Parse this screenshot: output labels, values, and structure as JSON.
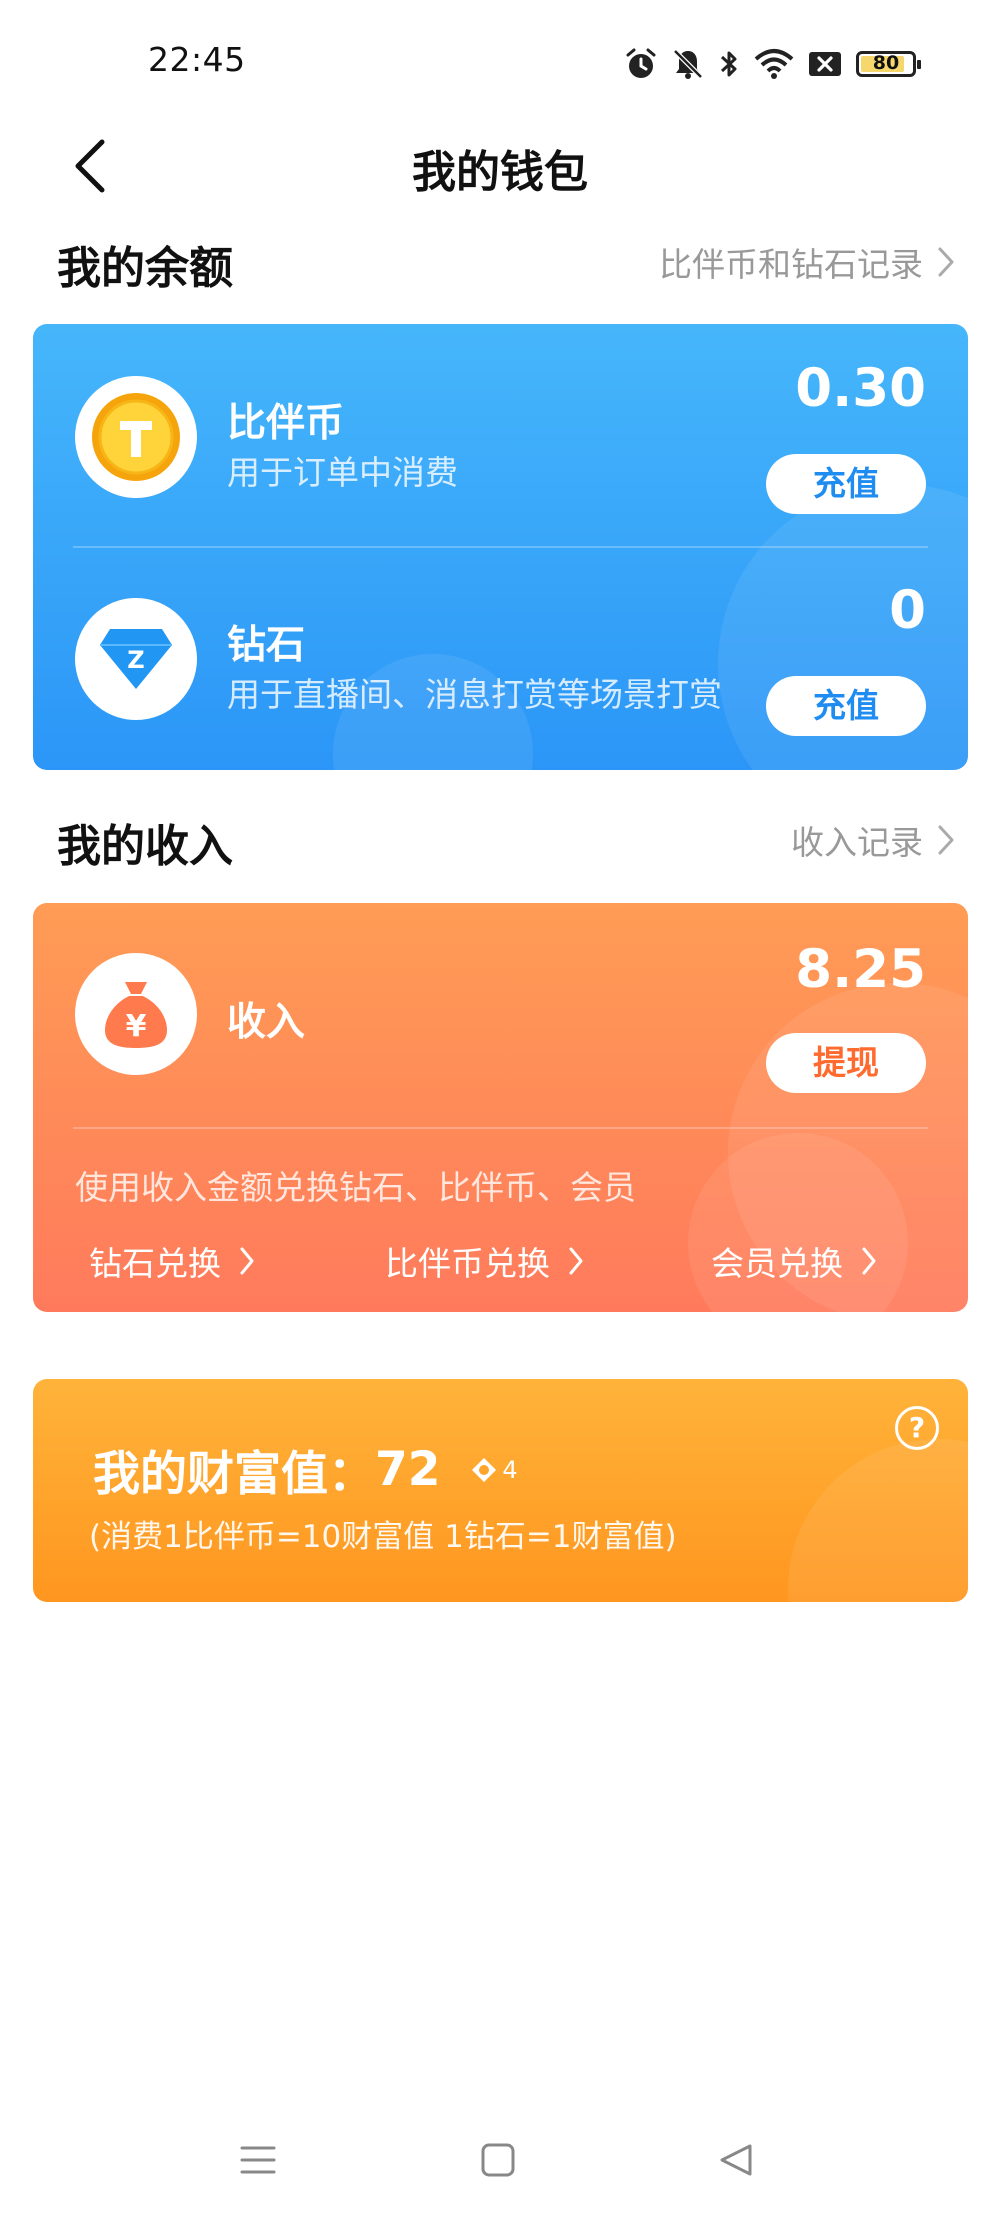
{
  "status_bar": {
    "time": "22:45",
    "battery": "80",
    "icons": [
      "alarm-icon",
      "mute-bell-icon",
      "bluetooth-icon",
      "wifi-icon",
      "sim-off-icon",
      "battery-icon"
    ]
  },
  "header": {
    "title": "我的钱包",
    "back_icon": "chevron-left-icon"
  },
  "balance_section": {
    "title": "我的余额",
    "link": "比伴币和钻石记录",
    "items": [
      {
        "name": "比伴币",
        "desc": "用于订单中消费",
        "amount": "0.30",
        "button": "充值",
        "icon": "coin-icon"
      },
      {
        "name": "钻石",
        "desc": "用于直播间、消息打赏等场景打赏",
        "amount": "0",
        "button": "充值",
        "icon": "diamond-icon"
      }
    ],
    "colors": {
      "card_top": "#46b6fb",
      "card_bottom": "#2b96f7",
      "button_text": "#1e8cf0"
    }
  },
  "income_section": {
    "title": "我的收入",
    "link": "收入记录",
    "name": "收入",
    "amount": "8.25",
    "button": "提现",
    "icon": "money-bag-icon",
    "exchange_hint": "使用收入金额兑换钻石、比伴币、会员",
    "exchanges": [
      "钻石兑换",
      "比伴币兑换",
      "会员兑换"
    ],
    "colors": {
      "card_top": "#ff9c55",
      "card_bottom": "#ff7a5c",
      "button_text": "#ff6a2e"
    }
  },
  "wealth": {
    "label": "我的财富值：",
    "value": "72",
    "level": "4",
    "note": "(消费1比伴币=10财富值 1钻石=1财富值)",
    "help_icon": "question-circle-icon",
    "colors": {
      "card_top": "#ffb33a",
      "card_bottom": "#ff961f"
    }
  },
  "nav_bar": {
    "icons": [
      "menu-icon",
      "home-square-icon",
      "back-triangle-icon"
    ]
  }
}
